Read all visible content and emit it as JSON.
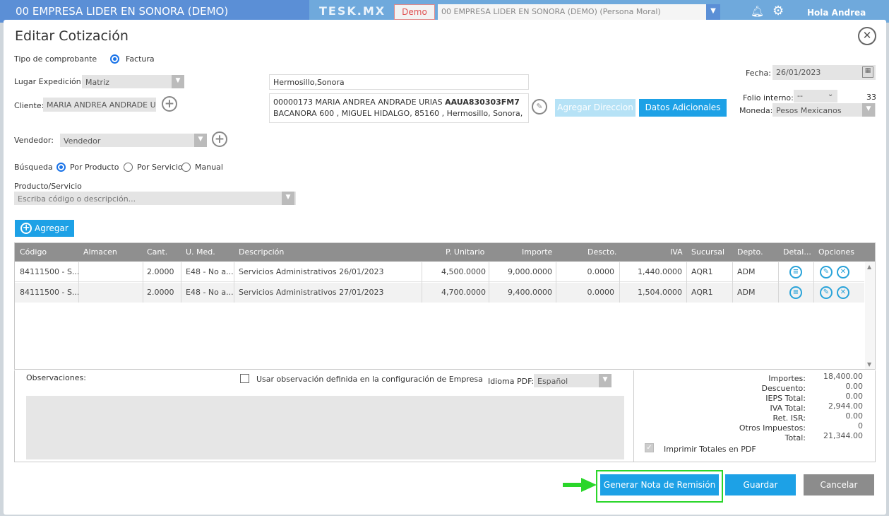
{
  "topbar": {
    "company": "00 EMPRESA LIDER EN SONORA (DEMO)",
    "logo": "TESK.MX",
    "demo_label": "Demo",
    "company_select": "00 EMPRESA LIDER EN SONORA (DEMO) (Persona Moral)",
    "greeting": "Hola Andrea",
    "bell_icon": "bell-icon",
    "gear_icon": "gear-icon"
  },
  "modal": {
    "title": "Editar Cotización",
    "close_icon": "close-icon"
  },
  "form": {
    "tipo_label": "Tipo de comprobante",
    "tipo_value": "Factura",
    "lugar_label": "Lugar Expedición",
    "lugar_value": "Matriz",
    "lugar_text": "Hermosillo,Sonora",
    "cliente_label": "Cliente:",
    "cliente_value": "MARIA ANDREA ANDRADE URI",
    "cliente_line1": "00000173 MARIA ANDREA ANDRADE URIAS",
    "cliente_rfc": "AAUA830303FM7",
    "cliente_line2": "BACANORA 600 , MIGUEL HIDALGO, 85160 , Hermosillo, Sonora, Me...",
    "agregar_direccion": "Agregar Direccion",
    "datos_adicionales": "Datos Adicionales",
    "fecha_label": "Fecha:",
    "fecha_value": "26/01/2023",
    "folio_label": "Folio interno:",
    "folio_select": "--",
    "folio_number": "33",
    "moneda_label": "Moneda:",
    "moneda_value": "Pesos Mexicanos",
    "vendedor_label": "Vendedor:",
    "vendedor_value": "Vendedor",
    "busqueda_label": "Búsqueda",
    "busqueda_options": [
      "Por Producto",
      "Por Servicio",
      "Manual"
    ],
    "producto_label": "Producto/Servicio",
    "producto_placeholder": "Escriba código o descripción...",
    "agregar_label": "Agregar"
  },
  "table": {
    "headers": [
      "Código",
      "Almacen",
      "Cant.",
      "U. Med.",
      "Descripción",
      "P. Unitario",
      "Importe",
      "Descto.",
      "IVA",
      "Sucursal",
      "Depto.",
      "Detal...",
      "Opciones"
    ],
    "rows": [
      [
        "84111500 - S...",
        "",
        "2.0000",
        "E48 - No a...",
        "Servicios Administrativos 26/01/2023",
        "4,500.0000",
        "9,000.0000",
        "0.0000",
        "1,440.0000",
        "AQR1",
        "ADM"
      ],
      [
        "84111500 - S...",
        "",
        "2.0000",
        "E48 - No a...",
        "Servicios Administrativos 27/01/2023",
        "4,700.0000",
        "9,400.0000",
        "0.0000",
        "1,504.0000",
        "AQR1",
        "ADM"
      ]
    ]
  },
  "bottom": {
    "observaciones_label": "Observaciones:",
    "usar_obs_label": "Usar observación definida en la configuración de Empresa",
    "idioma_label": "Idioma PDF:",
    "idioma_value": "Español",
    "totals": [
      {
        "label": "Importes:",
        "value": "18,400.00"
      },
      {
        "label": "Descuento:",
        "value": "0.00"
      },
      {
        "label": "IEPS Total:",
        "value": "0.00"
      },
      {
        "label": "IVA Total:",
        "value": "2,944.00"
      },
      {
        "label": "Ret. ISR:",
        "value": "0.00"
      },
      {
        "label": "Otros Impuestos:",
        "value": "0"
      },
      {
        "label": "Total:",
        "value": "21,344.00"
      }
    ],
    "imprimir_label": "Imprimir Totales en PDF"
  },
  "footer": {
    "generar_label": "Generar Nota de Remisión",
    "guardar_label": "Guardar",
    "cancelar_label": "Cancelar"
  }
}
